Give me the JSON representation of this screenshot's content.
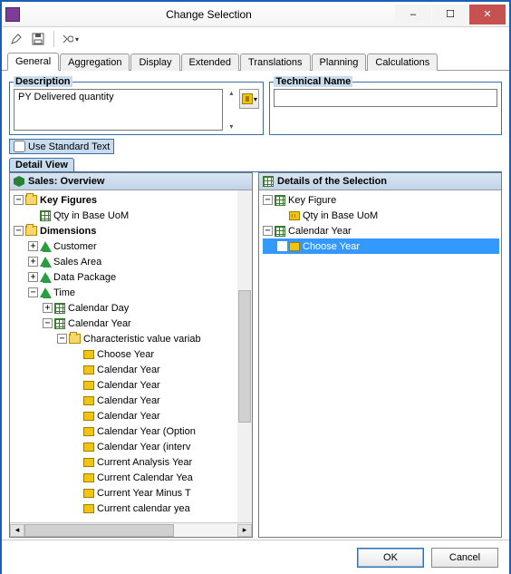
{
  "window": {
    "title": "Change Selection",
    "minimize": "–",
    "maximize": "☐",
    "close": "✕"
  },
  "tabs": [
    "General",
    "Aggregation",
    "Display",
    "Extended",
    "Translations",
    "Planning",
    "Calculations"
  ],
  "labels": {
    "description": "Description",
    "technicalName": "Technical Name",
    "useStd": "Use Standard Text",
    "detailView": "Detail View"
  },
  "description": {
    "value": "PY Delivered quantity"
  },
  "technicalName": {
    "value": ""
  },
  "leftPanel": {
    "title": "Sales: Overview",
    "kfHeader": "Key Figures",
    "kfItem": "Qty in Base UoM",
    "dimHeader": "Dimensions",
    "dims": {
      "d0": "Customer",
      "d1": "Sales Area",
      "d2": "Data Package",
      "d3": "Time"
    },
    "time": {
      "t0": "Calendar Day",
      "t1": "Calendar Year"
    },
    "charVar": "Characteristic value variab",
    "vars": {
      "v0": "Choose Year",
      "v1": "Calendar Year",
      "v2": "Calendar Year",
      "v3": "Calendar Year",
      "v4": "Calendar Year",
      "v5": "Calendar Year (Option",
      "v6": "Calendar Year (interv",
      "v7": "Current Analysis Year",
      "v8": "Current Calendar Yea",
      "v9": "Current Year Minus T",
      "v10": "Current calendar yea"
    }
  },
  "rightPanel": {
    "title": "Details of the Selection",
    "kf": "Key Figure",
    "kfItem": "Qty in Base UoM",
    "cy": "Calendar Year",
    "chooseYear": "Choose Year"
  },
  "buttons": {
    "ok": "OK",
    "cancel": "Cancel"
  }
}
